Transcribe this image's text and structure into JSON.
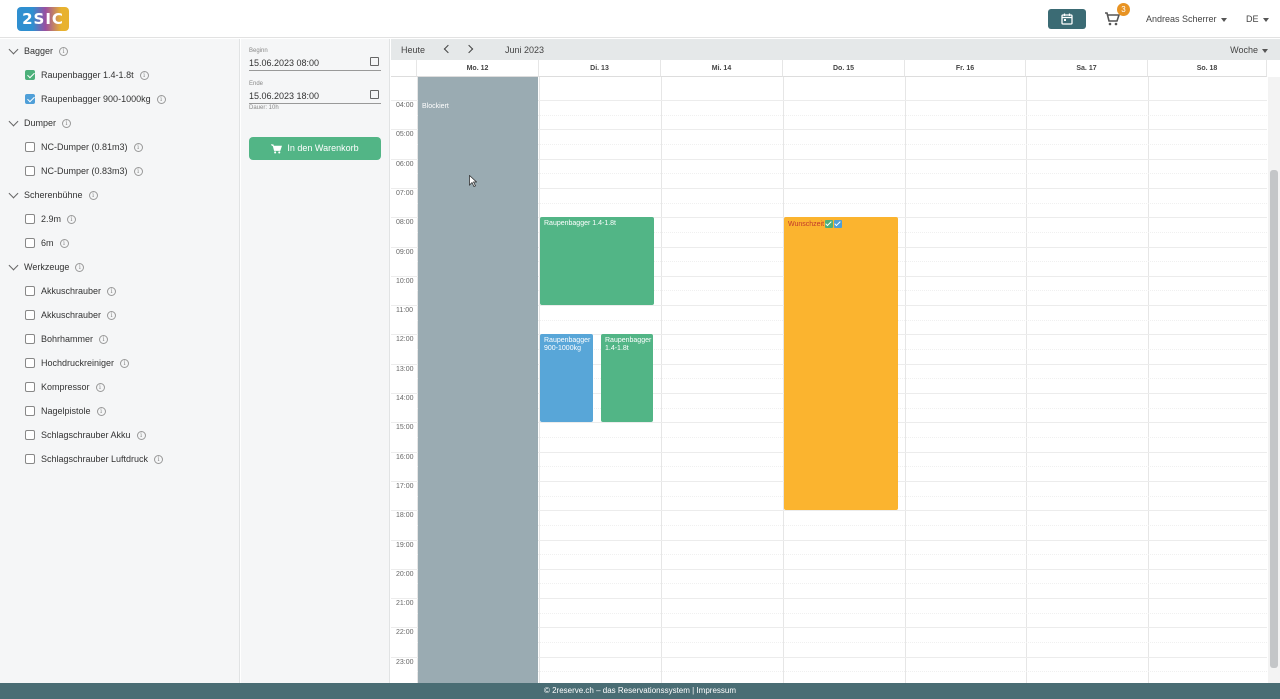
{
  "header": {
    "logo_text": "2SIC",
    "cart_count": "3",
    "user_name": "Andreas Scherrer",
    "language": "DE"
  },
  "sidebar": {
    "groups": [
      {
        "label": "Bagger",
        "items": [
          {
            "label": "Raupenbagger 1.4-1.8t",
            "checked": true,
            "color": "#4caf7a"
          },
          {
            "label": "Raupenbagger 900-1000kg",
            "checked": true,
            "color": "#4f9fd8"
          }
        ]
      },
      {
        "label": "Dumper",
        "items": [
          {
            "label": "NC-Dumper (0.81m3)",
            "checked": false
          },
          {
            "label": "NC-Dumper (0.83m3)",
            "checked": false
          }
        ]
      },
      {
        "label": "Scherenbühne",
        "items": [
          {
            "label": "2.9m",
            "checked": false
          },
          {
            "label": "6m",
            "checked": false
          }
        ]
      },
      {
        "label": "Werkzeuge",
        "items": [
          {
            "label": "Akkuschrauber",
            "checked": false
          },
          {
            "label": "Akkuschrauber",
            "checked": false
          },
          {
            "label": "Bohrhammer",
            "checked": false
          },
          {
            "label": "Hochdruckreiniger",
            "checked": false
          },
          {
            "label": "Kompressor",
            "checked": false
          },
          {
            "label": "Nagelpistole",
            "checked": false
          },
          {
            "label": "Schlagschrauber Akku",
            "checked": false
          },
          {
            "label": "Schlagschrauber Luftdruck",
            "checked": false
          }
        ]
      }
    ]
  },
  "booking": {
    "start_label": "Beginn",
    "start_value": "15.06.2023 08:00",
    "end_label": "Ende",
    "end_value": "15.06.2023 18:00",
    "duration": "Dauer: 10h",
    "add_to_cart": "In den Warenkorb"
  },
  "calendar": {
    "today": "Heute",
    "month": "Juni 2023",
    "view": "Woche",
    "days": [
      "Mo. 12",
      "Di. 13",
      "Mi. 14",
      "Do. 15",
      "Fr. 16",
      "Sa. 17",
      "So. 18"
    ],
    "hours": [
      "04:00",
      "05:00",
      "06:00",
      "07:00",
      "08:00",
      "09:00",
      "10:00",
      "11:00",
      "12:00",
      "13:00",
      "14:00",
      "15:00",
      "16:00",
      "17:00",
      "18:00",
      "19:00",
      "20:00",
      "21:00",
      "22:00",
      "23:00"
    ],
    "events": [
      {
        "title": "Blockiert",
        "day": 0,
        "start": 3.5,
        "end": 24,
        "color": "#9aabb2"
      },
      {
        "title": "Raupenbagger 1.4-1.8t",
        "day": 1,
        "start": 8,
        "end": 11,
        "color": "#52b586"
      },
      {
        "title": "Raupenbagger 900-1000kg",
        "day": 1,
        "start": 12,
        "end": 15,
        "color": "#58a6d8",
        "half": "left"
      },
      {
        "title": "Raupenbagger 1.4-1.8t",
        "day": 1,
        "start": 12,
        "end": 15,
        "color": "#52b586",
        "half": "right"
      },
      {
        "title": "Wunschzeit",
        "day": 3,
        "start": 8,
        "end": 18,
        "color": "#fbb42f",
        "text_color": "#c0392b"
      }
    ]
  },
  "footer": {
    "text": "© 2reserve.ch – das Reservationssystem | Impressum"
  },
  "colors": {
    "accent": "#3b6b74",
    "footer": "#4a6d74",
    "badge": "#e89323"
  }
}
